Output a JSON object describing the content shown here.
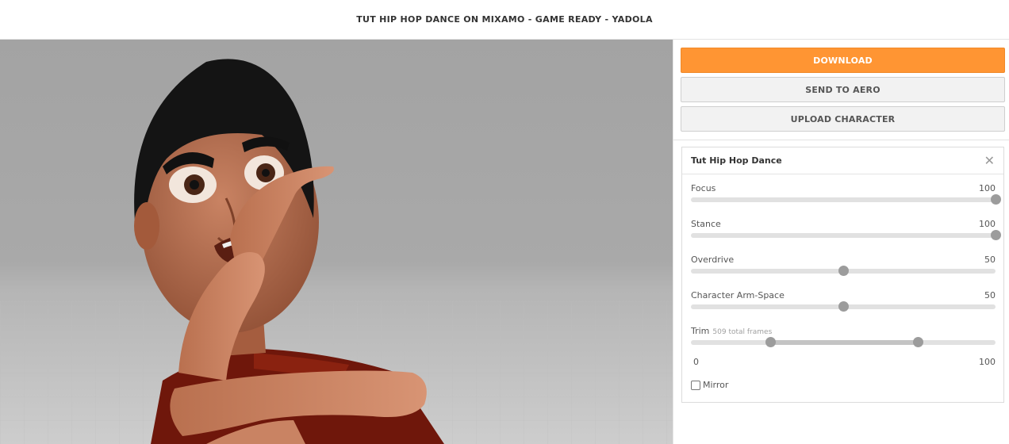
{
  "header": {
    "title": "TUT HIP HOP DANCE ON MIXAMO - GAME READY - YADOLA"
  },
  "actions": {
    "download": "DOWNLOAD",
    "send_to_aero": "SEND TO AERO",
    "upload_character": "UPLOAD CHARACTER"
  },
  "settings": {
    "title": "Tut Hip Hop Dance",
    "close_icon": "close-icon",
    "sliders": [
      {
        "label": "Focus",
        "value": "100",
        "fraction": 1.0
      },
      {
        "label": "Stance",
        "value": "100",
        "fraction": 1.0
      },
      {
        "label": "Overdrive",
        "value": "50",
        "fraction": 0.5
      },
      {
        "label": "Character Arm-Space",
        "value": "50",
        "fraction": 0.5
      }
    ],
    "trim": {
      "label": "Trim",
      "sublabel": "509 total frames",
      "start_fraction": 0.26,
      "end_fraction": 0.745,
      "min_label": "0",
      "max_label": "100"
    },
    "mirror": {
      "label": "Mirror",
      "checked": false
    }
  },
  "colors": {
    "accent": "#ff9533",
    "skin": "#c57a5b",
    "shirt": "#7a1a0c"
  }
}
